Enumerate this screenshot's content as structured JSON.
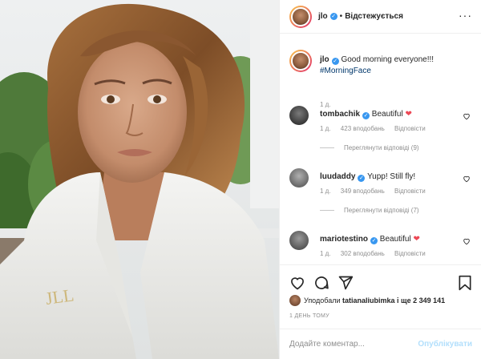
{
  "post": {
    "username": "jlo",
    "follow_status": "Відстежується",
    "more_icon": "more-icon"
  },
  "caption": {
    "username": "jlo",
    "text": "Good morning everyone!!!",
    "hashtag": "#MorningFace",
    "time": "1 д."
  },
  "comments": [
    {
      "username": "tombachik",
      "text": "Beautiful",
      "emoji": "❤",
      "time": "1 д.",
      "likes": "423 вподобань",
      "reply": "Відповісти",
      "view_replies": "Переглянути відповіді (9)"
    },
    {
      "username": "luudaddy",
      "text": "Yupp! Still fly!",
      "emoji": "",
      "time": "1 д.",
      "likes": "349 вподобань",
      "reply": "Відповісти",
      "view_replies": "Переглянути відповіді (7)"
    },
    {
      "username": "mariotestino",
      "text": "Beautiful",
      "emoji": "❤",
      "time": "1 д.",
      "likes": "302 вподобань",
      "reply": "Відповісти",
      "view_replies": ""
    }
  ],
  "likes": {
    "prefix": "Уподобали",
    "user": "tatianaliubimka",
    "suffix": "і ще 2 349 141"
  },
  "date": "1 ДЕНЬ ТОМУ",
  "add_comment": {
    "placeholder": "Додайте коментар...",
    "publish": "Опублікувати"
  },
  "colors": {
    "verified": "#3897f0",
    "heart": "#ed4956",
    "publish_disabled": "#b2dffc",
    "meta": "#8e8e8e"
  }
}
